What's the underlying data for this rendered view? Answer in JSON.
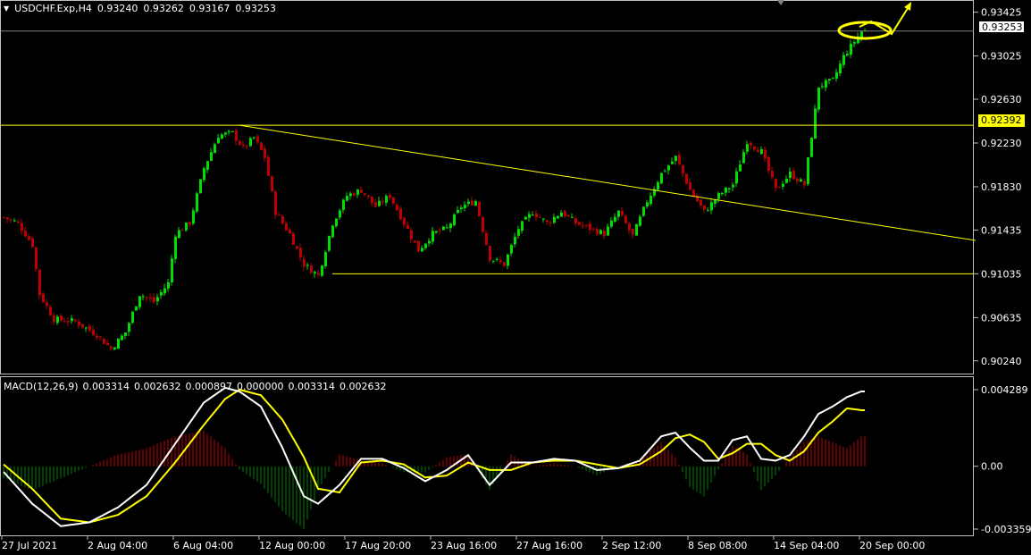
{
  "header": {
    "symbol": "USDCHF.Exp,H4",
    "open": "0.93240",
    "high": "0.93262",
    "low": "0.93167",
    "close": "0.93253"
  },
  "macd_header": {
    "label": "MACD(12,26,9)",
    "v1": "0.003314",
    "v2": "0.002632",
    "v3": "0.000897",
    "v4": "0.000000",
    "v5": "0.003314",
    "v6": "0.002632"
  },
  "price_tags": {
    "current": "0.93253",
    "level": "0.92392"
  },
  "colors": {
    "background": "#000000",
    "bull": "#00e000",
    "bear": "#c00000",
    "trendline": "#ffff00",
    "macd_main": "#ffffff",
    "macd_signal": "#ffff00"
  },
  "chart_data": [
    {
      "type": "candlestick",
      "title": "USDCHF.Exp,H4",
      "ylim": [
        0.9014,
        0.9352
      ],
      "y_ticks": [
        "0.93425",
        "0.93025",
        "0.92630",
        "0.92230",
        "0.91830",
        "0.91435",
        "0.91035",
        "0.90635",
        "0.90240"
      ],
      "x_ticks": [
        "27 Jul 2021",
        "2 Aug 04:00",
        "6 Aug 04:00",
        "12 Aug 00:00",
        "17 Aug 20:00",
        "23 Aug 16:00",
        "27 Aug 16:00",
        "2 Sep 12:00",
        "8 Sep 08:00",
        "14 Sep 04:00",
        "20 Sep 00:00"
      ],
      "close_path": [
        [
          0,
          0.9155
        ],
        [
          4,
          0.915
        ],
        [
          8,
          0.913
        ],
        [
          10,
          0.9085
        ],
        [
          14,
          0.9062
        ],
        [
          20,
          0.906
        ],
        [
          26,
          0.9048
        ],
        [
          30,
          0.9035
        ],
        [
          34,
          0.905
        ],
        [
          38,
          0.9085
        ],
        [
          42,
          0.9078
        ],
        [
          46,
          0.9095
        ],
        [
          48,
          0.914
        ],
        [
          52,
          0.915
        ],
        [
          56,
          0.92
        ],
        [
          60,
          0.923
        ],
        [
          64,
          0.9232
        ],
        [
          67,
          0.9218
        ],
        [
          70,
          0.9228
        ],
        [
          73,
          0.921
        ],
        [
          76,
          0.916
        ],
        [
          80,
          0.914
        ],
        [
          84,
          0.9112
        ],
        [
          88,
          0.9102
        ],
        [
          92,
          0.915
        ],
        [
          96,
          0.9175
        ],
        [
          100,
          0.918
        ],
        [
          104,
          0.9165
        ],
        [
          108,
          0.9175
        ],
        [
          112,
          0.915
        ],
        [
          116,
          0.9125
        ],
        [
          120,
          0.914
        ],
        [
          124,
          0.9145
        ],
        [
          128,
          0.9165
        ],
        [
          132,
          0.917
        ],
        [
          136,
          0.9118
        ],
        [
          140,
          0.9112
        ],
        [
          144,
          0.9145
        ],
        [
          148,
          0.916
        ],
        [
          152,
          0.915
        ],
        [
          156,
          0.916
        ],
        [
          160,
          0.915
        ],
        [
          164,
          0.9145
        ],
        [
          168,
          0.914
        ],
        [
          172,
          0.916
        ],
        [
          176,
          0.9138
        ],
        [
          180,
          0.917
        ],
        [
          184,
          0.9195
        ],
        [
          188,
          0.921
        ],
        [
          192,
          0.918
        ],
        [
          196,
          0.916
        ],
        [
          200,
          0.9175
        ],
        [
          204,
          0.9185
        ],
        [
          208,
          0.9225
        ],
        [
          212,
          0.9215
        ],
        [
          216,
          0.918
        ],
        [
          220,
          0.9195
        ],
        [
          224,
          0.9185
        ],
        [
          228,
          0.9275
        ],
        [
          232,
          0.928
        ],
        [
          235,
          0.9302
        ],
        [
          240,
          0.9325
        ]
      ],
      "horizontal_levels": [
        0.92392,
        0.91035
      ],
      "current_price": 0.93253,
      "trendline": [
        [
          0.92392,
          66
        ],
        [
          0.9134,
          272
        ]
      ]
    },
    {
      "type": "line",
      "title": "MACD(12,26,9)",
      "ylim": [
        -0.003359,
        0.004289
      ],
      "y_ticks": [
        "0.004289",
        "0.00",
        "-0.003359"
      ],
      "series": [
        {
          "name": "MACD",
          "x": [
            0,
            8,
            16,
            24,
            32,
            40,
            48,
            56,
            62,
            66,
            72,
            78,
            84,
            88,
            94,
            100,
            106,
            112,
            118,
            124,
            130,
            136,
            142,
            148,
            154,
            160,
            166,
            172,
            178,
            184,
            188,
            192,
            196,
            200,
            204,
            208,
            212,
            216,
            220,
            224,
            228,
            232,
            236,
            240
          ],
          "values": [
            -0.0003,
            -0.002,
            -0.0032,
            -0.003,
            -0.0022,
            -0.001,
            0.0012,
            0.0034,
            0.0042,
            0.004,
            0.0032,
            0.001,
            -0.0016,
            -0.002,
            -0.001,
            0.0004,
            0.0004,
            -0.0001,
            -0.0008,
            -0.0002,
            0.0006,
            -0.001,
            0.0002,
            0.0002,
            0.0004,
            0.0003,
            -0.0002,
            -0.0001,
            0.0003,
            0.0016,
            0.0018,
            0.001,
            0.0003,
            0.0003,
            0.0014,
            0.0016,
            0.0004,
            0.0003,
            0.0006,
            0.0016,
            0.0028,
            0.0032,
            0.0037,
            0.004
          ]
        },
        {
          "name": "Signal",
          "x": [
            0,
            8,
            16,
            24,
            32,
            40,
            48,
            56,
            62,
            66,
            72,
            78,
            84,
            88,
            94,
            100,
            106,
            112,
            118,
            124,
            130,
            136,
            142,
            148,
            154,
            160,
            166,
            172,
            178,
            184,
            188,
            192,
            196,
            200,
            204,
            208,
            212,
            216,
            220,
            224,
            228,
            232,
            236,
            240
          ],
          "values": [
            0.0001,
            -0.0012,
            -0.0028,
            -0.003,
            -0.0026,
            -0.0016,
            0.0002,
            0.0022,
            0.0036,
            0.0041,
            0.0038,
            0.0025,
            0.0005,
            -0.0012,
            -0.0014,
            0.0002,
            0.0003,
            0.0001,
            -0.0006,
            -0.0005,
            0.0002,
            -0.0002,
            -0.0002,
            0.0002,
            0.0003,
            0.0003,
            0.0001,
            -0.0001,
            0.0001,
            0.0008,
            0.0015,
            0.0017,
            0.0013,
            0.0004,
            0.0007,
            0.0012,
            0.0012,
            0.0006,
            0.0003,
            0.0008,
            0.0018,
            0.0024,
            0.0031,
            0.003
          ]
        }
      ]
    }
  ]
}
